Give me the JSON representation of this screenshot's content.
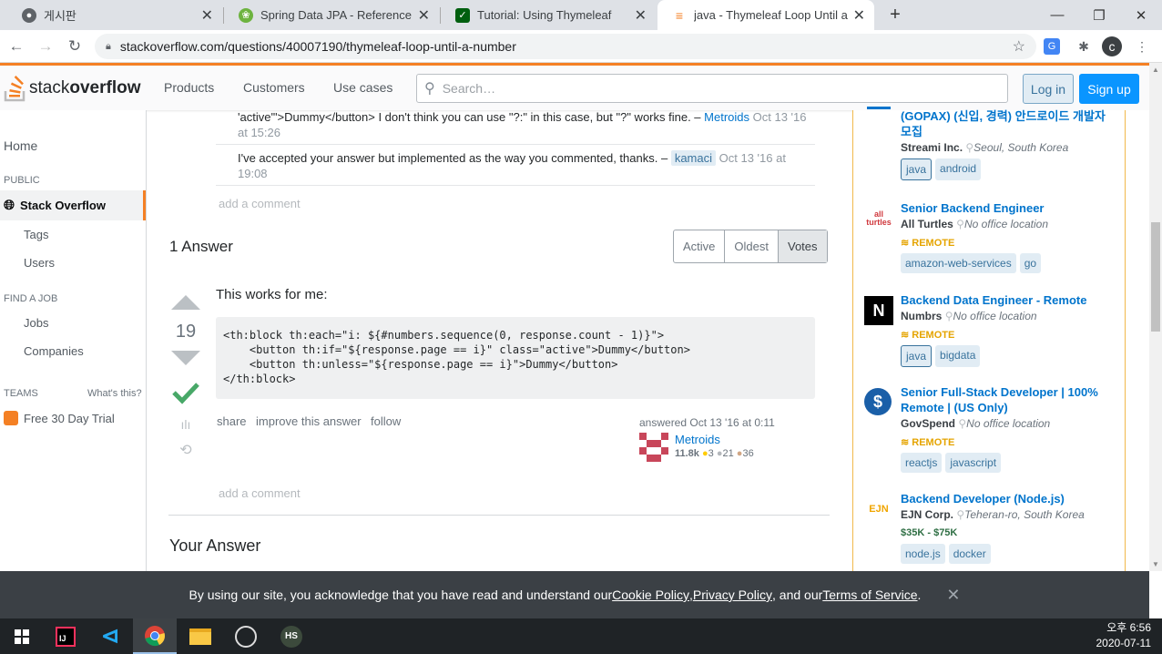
{
  "browser": {
    "tabs": [
      {
        "title": "게시판",
        "color": "#5f6368"
      },
      {
        "title": "Spring Data JPA - Reference Do",
        "color": "#6db33f"
      },
      {
        "title": "Tutorial: Using Thymeleaf",
        "color": "#005f0f"
      },
      {
        "title": "java - Thymeleaf Loop Until a N",
        "color": "#f48024"
      }
    ],
    "url": "stackoverflow.com/questions/40007190/thymeleaf-loop-until-a-number",
    "profile_initial": "c"
  },
  "header": {
    "logo_a": "stack",
    "logo_b": "overflow",
    "nav": [
      "Products",
      "Customers",
      "Use cases"
    ],
    "search_placeholder": "Search…",
    "login": "Log in",
    "signup": "Sign up"
  },
  "leftnav": {
    "home": "Home",
    "public": "PUBLIC",
    "so": "Stack Overflow",
    "tags": "Tags",
    "users": "Users",
    "findjob": "FIND A JOB",
    "jobs": "Jobs",
    "companies": "Companies",
    "teams": "TEAMS",
    "whats": "What's this?",
    "trial": "Free 30 Day Trial"
  },
  "comments": [
    {
      "text": "'active'\">Dummy</button> I don't think you can use \"?:\" in this case, but \"?\" works fine. –",
      "user": "Metroids",
      "date": "Oct 13 '16 at 15:26"
    },
    {
      "text": "I've accepted your answer but implemented as the way you commented, thanks. –",
      "user": "kamaci",
      "date": "Oct 13 '16 at 19:08"
    }
  ],
  "add_comment": "add a comment",
  "answers_title": "1 Answer",
  "sort": [
    "Active",
    "Oldest",
    "Votes"
  ],
  "answer": {
    "score": "19",
    "text": "This works for me:",
    "code": [
      "<th:block th:each=\"i: ${#numbers.sequence(0, response.count - 1)}\">",
      "    <button th:if=\"${response.page == i}\" class=\"active\">Dummy</button>",
      "    <button th:unless=\"${response.page == i}\">Dummy</button>",
      "</th:block>"
    ],
    "actions": [
      "share",
      "improve this answer",
      "follow"
    ],
    "answered": "answered Oct 13 '16 at 0:11",
    "user": "Metroids",
    "rep": "11.8k",
    "gold": "3",
    "silver": "21",
    "bronze": "36"
  },
  "your_answer": "Your Answer",
  "jobs": [
    {
      "title": "(GOPAX) (신입, 경력) 안드로이드 개발자 모집",
      "company": "Streami Inc.",
      "location": "Seoul, South Korea",
      "remote": "",
      "salary": "",
      "tags": [
        "java",
        "android"
      ],
      "logo": "",
      "logo_color": "#0074cc"
    },
    {
      "title": "Senior Backend Engineer",
      "company": "All Turtles",
      "location": "No office location",
      "remote": "REMOTE",
      "salary": "",
      "tags": [
        "amazon-web-services",
        "go"
      ],
      "logo": "all turtles",
      "logo_color": "#d0393e"
    },
    {
      "title": "Backend Data Engineer - Remote",
      "company": "Numbrs",
      "location": "No office location",
      "remote": "REMOTE",
      "salary": "",
      "tags": [
        "java",
        "bigdata"
      ],
      "logo": "N",
      "logo_color": "#000000"
    },
    {
      "title": "Senior Full-Stack Developer | 100% Remote | (US Only)",
      "company": "GovSpend",
      "location": "No office location",
      "remote": "REMOTE",
      "salary": "",
      "tags": [
        "reactjs",
        "javascript"
      ],
      "logo": "$",
      "logo_color": "#1a5fa8"
    },
    {
      "title": "Backend Developer (Node.js)",
      "company": "EJN Corp.",
      "location": "Teheran-ro, South Korea",
      "remote": "",
      "salary": "$35K - $75K",
      "tags": [
        "node.js",
        "docker"
      ],
      "logo": "EJN",
      "logo_color": "#f0a500"
    }
  ],
  "cookie": {
    "pre": "By using our site, you acknowledge that you have read and understand our ",
    "l1": "Cookie Policy",
    "c1": ", ",
    "l2": "Privacy Policy",
    "c2": ", and our ",
    "l3": "Terms of Service",
    "post": "."
  },
  "clock": {
    "time": "오후 6:56",
    "date": "2020-07-11"
  }
}
